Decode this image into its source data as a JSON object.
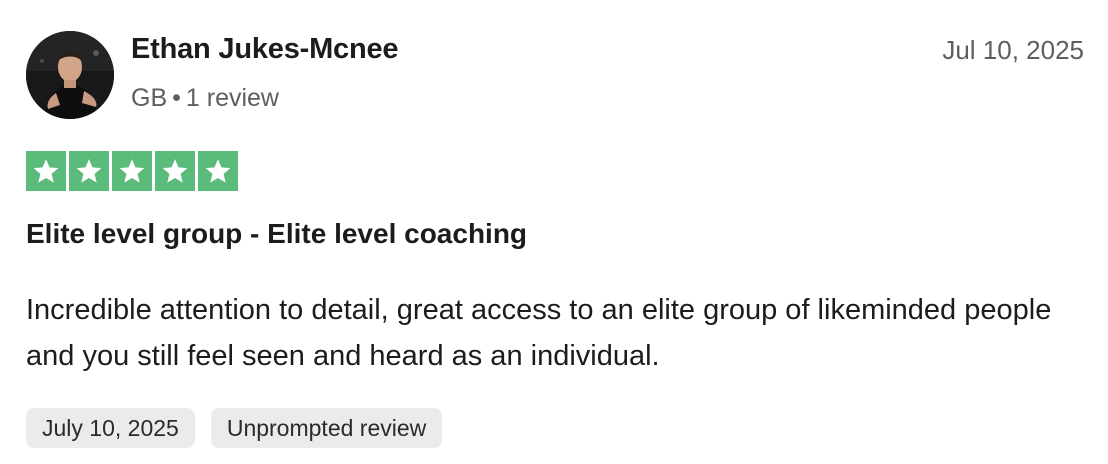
{
  "reviewer": {
    "name": "Ethan Jukes-Mcnee",
    "country": "GB",
    "separator": "•",
    "review_count": "1 review"
  },
  "review": {
    "date": "Jul 10, 2025",
    "rating": 5,
    "rating_max": 5,
    "star_color": "#5bbb7b",
    "title": "Elite level group - Elite level coaching",
    "body": "Incredible attention to detail, great access to an elite group of likeminded people and you still feel seen and heard as an individual."
  },
  "tags": [
    {
      "label": "July 10, 2025"
    },
    {
      "label": "Unprompted review"
    }
  ]
}
